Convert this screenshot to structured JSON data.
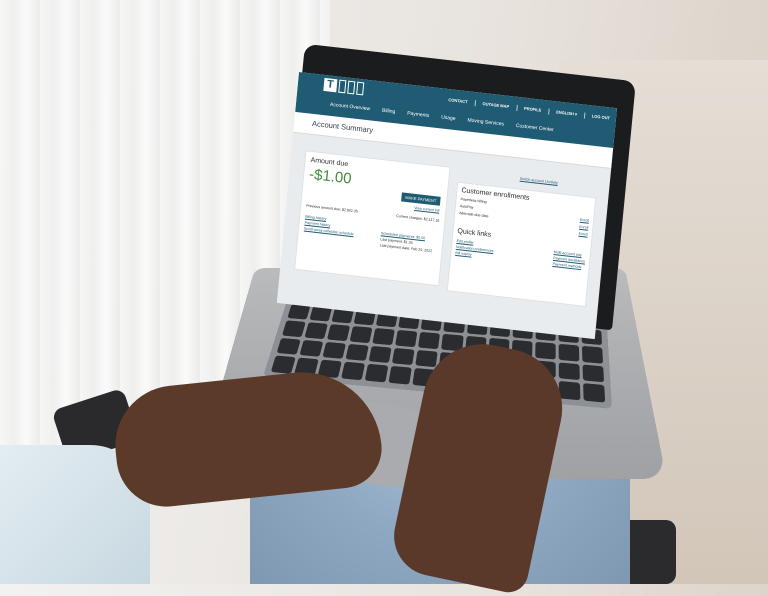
{
  "app": {
    "logo_letter": "T",
    "utility_nav": [
      "CONTACT",
      "OUTAGE MAP",
      "PROFILE",
      "ENGLISH",
      "LOG OUT"
    ],
    "language_caret": "▾",
    "main_nav": [
      "Account Overview",
      "Billing",
      "Payments",
      "Usage",
      "Moving Services",
      "Customer Center"
    ],
    "page_title": "Account Summary"
  },
  "account_links": {
    "switch_account": "Switch account",
    "activity": "Activity"
  },
  "amount_due": {
    "title": "Amount due",
    "value": "-$1.00",
    "make_payment": "MAKE PAYMENT",
    "view_current_bill": "View current bill",
    "previous_amount_due": "Previous amount due: $2,802.35",
    "current_charges": "Current charges: $2,117.16",
    "links": [
      "Billing history",
      "Payment history",
      "Scroll-away collection schedule"
    ],
    "scheduled_payments": "Scheduled payments: $0.00",
    "last_payment": "Last payment: $1.00",
    "last_payment_date": "Last payment date: Feb 25, 2022"
  },
  "customer_enrollments": {
    "title": "Customer enrollments",
    "items": [
      {
        "label": "Paperless billing",
        "action": ""
      },
      {
        "label": "AutoPay",
        "action": "Enroll"
      },
      {
        "label": "Alternate due date",
        "action": "Enroll"
      },
      {
        "label": "",
        "action": "Enroll"
      }
    ]
  },
  "quick_links": {
    "title": "Quick links",
    "left": [
      "Edit profile",
      "Notification preferences",
      "Bill inquiry"
    ],
    "right": [
      "Multi-account pay",
      "Payment assistance",
      "Payment methods"
    ]
  },
  "colors": {
    "brand": "#1f5c73",
    "credit_green": "#3f8b3a"
  }
}
